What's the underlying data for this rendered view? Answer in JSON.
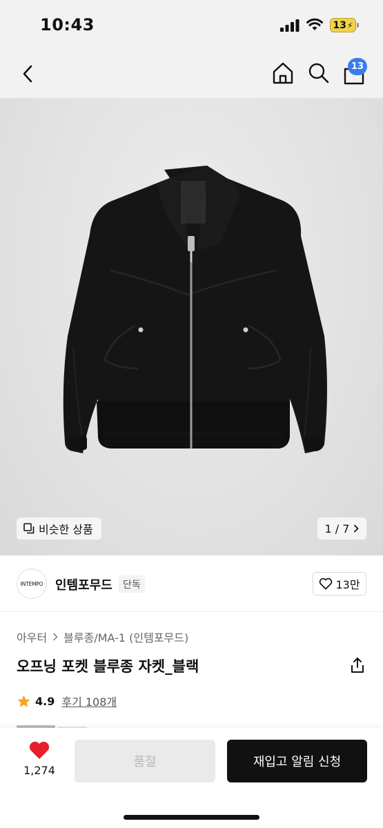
{
  "status": {
    "time": "10:43",
    "battery": "13"
  },
  "nav": {
    "cart_count": "13"
  },
  "hero": {
    "similar_label": "비슷한 상품",
    "counter": "1 / 7"
  },
  "brand": {
    "logo_text": "INTEMPO",
    "name": "인템포무드",
    "tag": "단독",
    "likes": "13만"
  },
  "product": {
    "breadcrumb": [
      "아우터",
      "블루종/MA-1 (인템포무드)"
    ],
    "title": "오프닝 포켓 블루종 자켓_블랙",
    "rating": "4.9",
    "reviews": "후기 108개"
  },
  "bottom": {
    "wish_count": "1,274",
    "soldout_label": "품절",
    "restock_label": "재입고 알림 신청"
  },
  "colors": {
    "accent": "#3b7bf0",
    "heart": "#e8202a",
    "star": "#f5a623",
    "primary_button": "#111111",
    "disabled_button": "#eaeaea"
  },
  "icons": [
    "chevron-left-icon",
    "home-icon",
    "search-icon",
    "shopping-bag-icon",
    "similar-items-icon",
    "chevron-right-icon",
    "heart-outline-icon",
    "share-icon",
    "star-icon",
    "heart-filled-icon"
  ]
}
